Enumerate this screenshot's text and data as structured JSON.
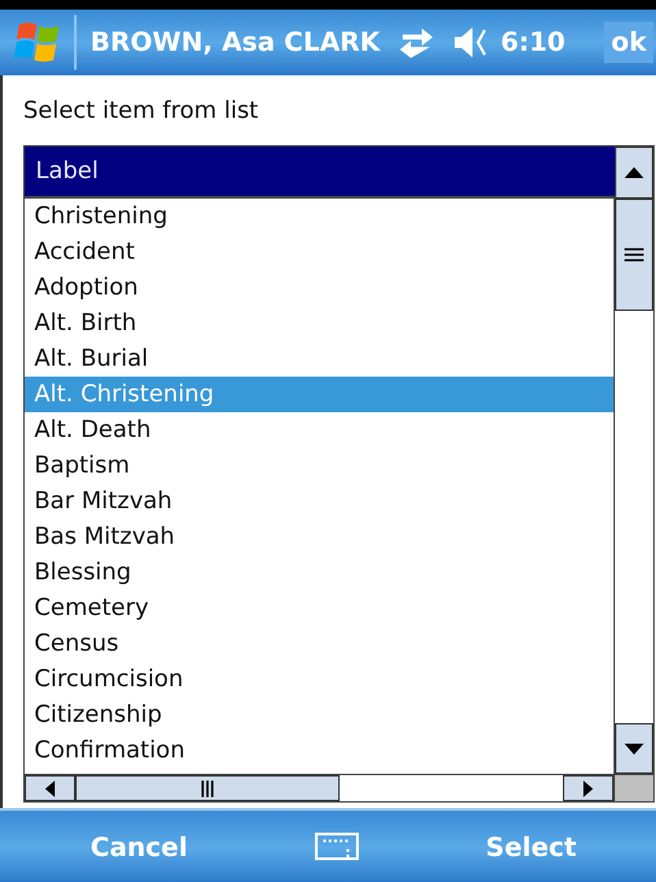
{
  "title_bar": {
    "title": "BROWN, Asa CLARK",
    "time": "6:10",
    "ok_button": "ok"
  },
  "prompt": "Select item from list",
  "list": {
    "header": "Label",
    "items": [
      {
        "label": "Christening",
        "selected": false
      },
      {
        "label": "Accident",
        "selected": false
      },
      {
        "label": "Adoption",
        "selected": false
      },
      {
        "label": "Alt. Birth",
        "selected": false
      },
      {
        "label": "Alt. Burial",
        "selected": false
      },
      {
        "label": "Alt. Christening",
        "selected": true
      },
      {
        "label": "Alt. Death",
        "selected": false
      },
      {
        "label": "Baptism",
        "selected": false
      },
      {
        "label": "Bar Mitzvah",
        "selected": false
      },
      {
        "label": "Bas Mitzvah",
        "selected": false
      },
      {
        "label": "Blessing",
        "selected": false
      },
      {
        "label": "Cemetery",
        "selected": false
      },
      {
        "label": "Census",
        "selected": false
      },
      {
        "label": "Circumcision",
        "selected": false
      },
      {
        "label": "Citizenship",
        "selected": false
      },
      {
        "label": "Confirmation",
        "selected": false
      }
    ]
  },
  "menu_bar": {
    "left": "Cancel",
    "right": "Select"
  }
}
